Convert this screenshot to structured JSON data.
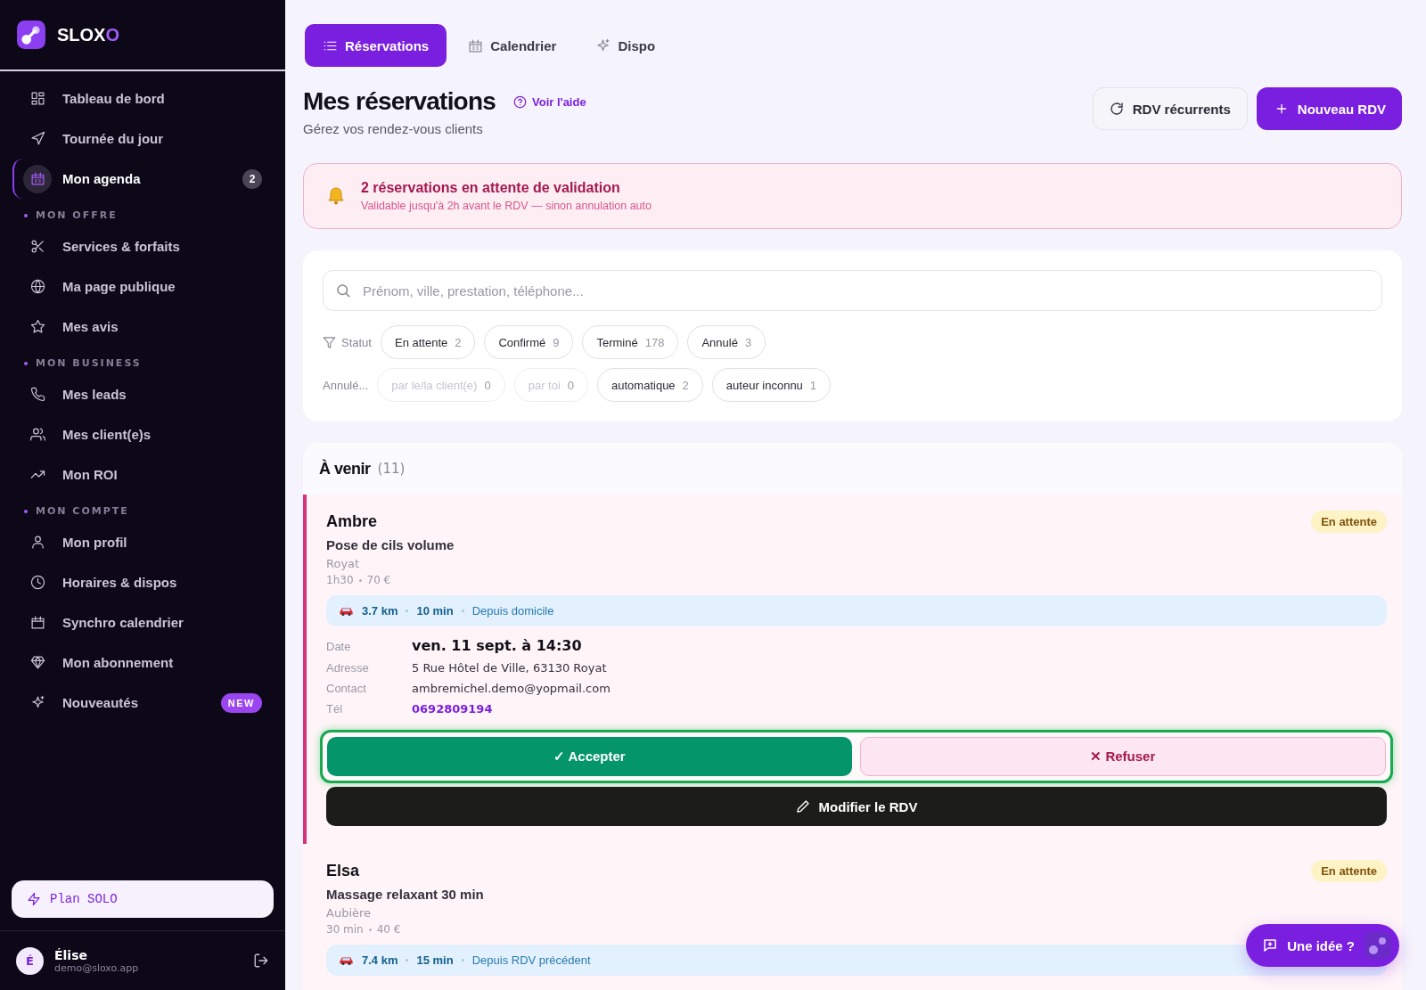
{
  "brand": {
    "name": "SLOX",
    "accent": "O"
  },
  "sidebar": {
    "groups": [
      {
        "items": [
          {
            "label": "Tableau de bord",
            "selected": false
          },
          {
            "label": "Tournée du jour",
            "selected": false
          },
          {
            "label": "Mon agenda",
            "selected": true,
            "badge": {
              "text": "2",
              "kind": "count"
            }
          }
        ]
      },
      {
        "title": "MON OFFRE",
        "items": [
          {
            "label": "Services & forfaits",
            "selected": false
          },
          {
            "label": "Ma page publique",
            "selected": false
          },
          {
            "label": "Mes avis",
            "selected": false
          }
        ]
      },
      {
        "title": "MON BUSINESS",
        "items": [
          {
            "label": "Mes leads",
            "selected": false
          },
          {
            "label": "Mes client(e)s",
            "selected": false
          },
          {
            "label": "Mon ROI",
            "selected": false
          }
        ]
      },
      {
        "title": "MON COMPTE",
        "items": [
          {
            "label": "Mon profil",
            "selected": false
          },
          {
            "label": "Horaires & dispos",
            "selected": false
          },
          {
            "label": "Synchro calendrier",
            "selected": false
          },
          {
            "label": "Mon abonnement",
            "selected": false
          },
          {
            "label": "Nouveautés",
            "selected": false,
            "badge": {
              "text": "NEW",
              "kind": "new"
            }
          }
        ]
      }
    ]
  },
  "plan": {
    "label": "Plan SOLO"
  },
  "user": {
    "initial": "É",
    "name": "Élise",
    "email": "demo@sloxo.app"
  },
  "tabs": [
    {
      "label": "Réservations",
      "selected": true
    },
    {
      "label": "Calendrier",
      "selected": false
    },
    {
      "label": "Dispo",
      "selected": false
    }
  ],
  "header": {
    "title": "Mes réservations",
    "help_link": "Voir l'aide",
    "subtitle": "Gérez vos rendez-vous clients",
    "buttons": [
      {
        "label": "RDV récurrents",
        "kind": "secondary"
      },
      {
        "label": "Nouveau RDV",
        "kind": "primary"
      }
    ]
  },
  "alert": {
    "title": "2 réservations en attente de validation",
    "subtitle": "Validable jusqu'à 2h avant le RDV — sinon annulation auto"
  },
  "search": {
    "placeholder": "Prénom, ville, prestation, téléphone..."
  },
  "filters": [
    {
      "label": "Statut",
      "kind": "status",
      "chips": [
        {
          "label": "En attente",
          "count": "2",
          "disabled": false
        },
        {
          "label": "Confirmé",
          "count": "9",
          "disabled": false
        },
        {
          "label": "Terminé",
          "count": "178",
          "disabled": false
        },
        {
          "label": "Annulé",
          "count": "3",
          "disabled": false
        }
      ]
    },
    {
      "label": "Annulé...",
      "kind": "cancel",
      "chips": [
        {
          "label": "par le/la client(e)",
          "count": "0",
          "disabled": true
        },
        {
          "label": "par toi",
          "count": "0",
          "disabled": true
        },
        {
          "label": "automatique",
          "count": "2",
          "disabled": false
        },
        {
          "label": "auteur inconnu",
          "count": "1",
          "disabled": false
        }
      ]
    }
  ],
  "section": {
    "title": "À venir",
    "count": "(11)"
  },
  "bookings": [
    {
      "name": "Ambre",
      "status": {
        "label": "En attente",
        "kind": "pending"
      },
      "service": "Pose de cils volume",
      "city": "Royat",
      "duration": "1h30",
      "price": "70 €",
      "highlighted": true,
      "travel": {
        "distance": "3.7 km",
        "time": "10 min",
        "origin": "Depuis domicile"
      },
      "details": [
        {
          "label": "Date",
          "value": "ven. 11 sept. à 14:30",
          "kind": "date"
        },
        {
          "label": "Adresse",
          "value": "5 Rue Hôtel de Ville, 63130 Royat",
          "kind": "text"
        },
        {
          "label": "Contact",
          "value": "ambremichel.demo@yopmail.com",
          "kind": "text"
        },
        {
          "label": "Tél",
          "value": "0692809194",
          "kind": "phone"
        }
      ],
      "actions": {
        "accept": "✓ Accepter",
        "refuse": "✕ Refuser",
        "edit": "Modifier le RDV"
      }
    },
    {
      "name": "Elsa",
      "status": {
        "label": "En attente",
        "kind": "pending"
      },
      "service": "Massage relaxant 30 min",
      "city": "Aubière",
      "duration": "30 min",
      "price": "40 €",
      "highlighted": false,
      "travel": {
        "distance": "7.4 km",
        "time": "15 min",
        "origin": "Depuis RDV précédent"
      }
    }
  ],
  "feedback_button": {
    "label": "Une idée ?"
  }
}
